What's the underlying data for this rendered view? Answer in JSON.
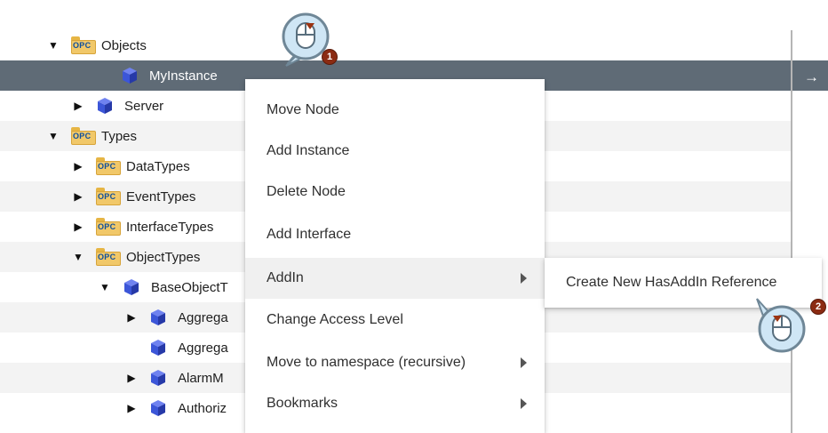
{
  "tree": {
    "rows": [
      {
        "label": "Objects",
        "toggle": "▼",
        "icon": "opc-folder"
      },
      {
        "label": "MyInstance",
        "toggle": "",
        "icon": "cube"
      },
      {
        "label": "Server",
        "toggle": "▶",
        "icon": "cube"
      },
      {
        "label": "Types",
        "toggle": "▼",
        "icon": "opc-folder"
      },
      {
        "label": "DataTypes",
        "toggle": "▶",
        "icon": "opc-folder"
      },
      {
        "label": "EventTypes",
        "toggle": "▶",
        "icon": "opc-folder"
      },
      {
        "label": "InterfaceTypes",
        "toggle": "▶",
        "icon": "opc-folder"
      },
      {
        "label": "ObjectTypes",
        "toggle": "▼",
        "icon": "opc-folder"
      },
      {
        "label": "BaseObjectT",
        "toggle": "▼",
        "icon": "cube"
      },
      {
        "label": "Aggrega",
        "toggle": "▶",
        "icon": "cube"
      },
      {
        "label": "Aggrega",
        "toggle": "",
        "icon": "cube"
      },
      {
        "label": "AlarmM",
        "toggle": "▶",
        "icon": "cube"
      },
      {
        "label": "Authoriz",
        "toggle": "▶",
        "icon": "cube"
      }
    ],
    "opc_badge": "OPC",
    "selected_arrow": "→"
  },
  "context_menu": {
    "items": [
      {
        "label": "Move Node",
        "has_submenu": false
      },
      {
        "label": "Add Instance",
        "has_submenu": false
      },
      {
        "label": "Delete Node",
        "has_submenu": false
      },
      {
        "label": "Add Interface",
        "has_submenu": false
      },
      {
        "label": "AddIn",
        "has_submenu": true
      },
      {
        "label": "Change Access Level",
        "has_submenu": false
      },
      {
        "label": "Move to namespace (recursive)",
        "has_submenu": true
      },
      {
        "label": "Bookmarks",
        "has_submenu": true
      }
    ]
  },
  "submenu": {
    "items": [
      {
        "label": "Create New HasAddIn Reference"
      }
    ]
  },
  "callouts": [
    {
      "step": "1",
      "icon": "mouse-right-click-icon"
    },
    {
      "step": "2",
      "icon": "mouse-left-click-icon"
    }
  ],
  "colors": {
    "selection": "#5f6b76",
    "alt_row": "#f3f3f3",
    "menu_bg": "#ffffff",
    "callout_fill": "#cfe6f5",
    "callout_stroke": "#6f8797",
    "badge": "#8b2b12",
    "opc_folder": "#f1c869",
    "cube": "#3c56d8"
  }
}
